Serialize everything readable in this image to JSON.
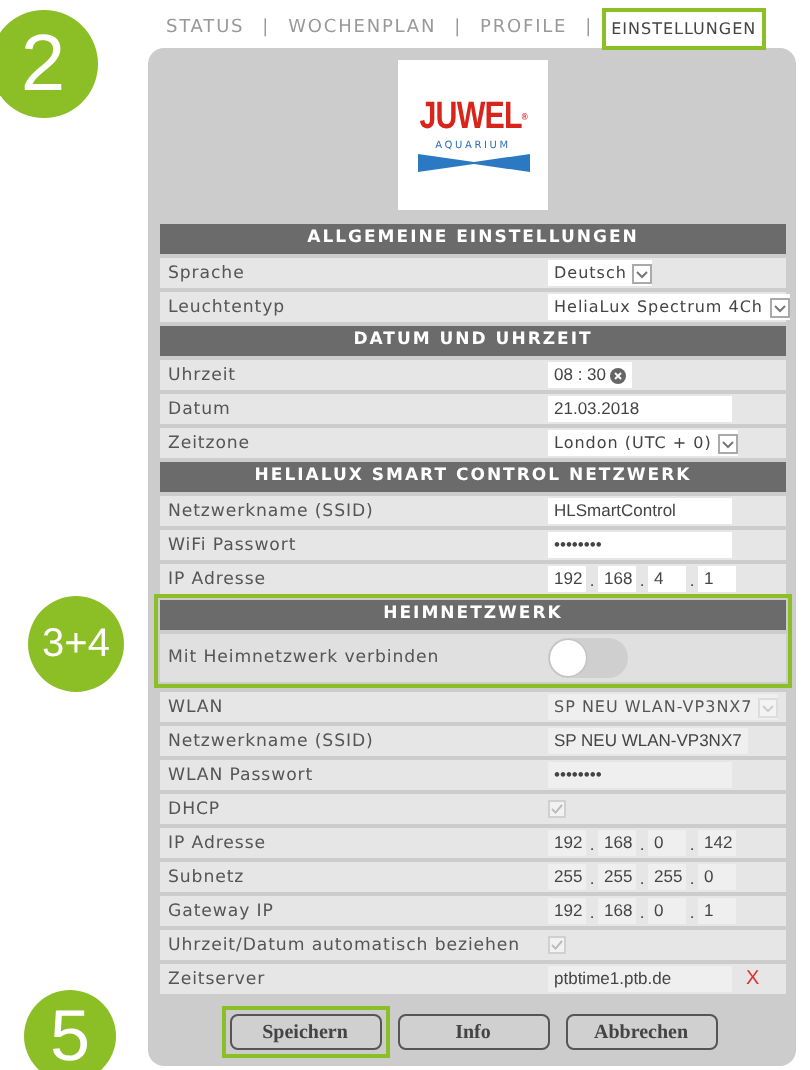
{
  "nav": {
    "callout": "2",
    "separator": "|",
    "items": [
      {
        "label": "STATUS",
        "selected": false,
        "highlighted": false
      },
      {
        "label": "WOCHENPLAN",
        "selected": false,
        "highlighted": false
      },
      {
        "label": "PROFILE",
        "selected": false,
        "highlighted": false
      },
      {
        "label": "EINSTELLUNGEN",
        "selected": true,
        "highlighted": true
      }
    ]
  },
  "logo": {
    "brand": "JUWEL",
    "mark": "®",
    "tagline": "AQUARIUM"
  },
  "ip_separator": ".",
  "sections": [
    {
      "title": "ALLGEMEINE EINSTELLUNGEN",
      "rows": [
        {
          "kind": "select",
          "label": "Sprache",
          "value": "Deutsch",
          "disabled": false
        },
        {
          "kind": "select",
          "label": "Leuchtentyp",
          "value": "HeliaLux Spectrum 4Ch",
          "disabled": false
        }
      ]
    },
    {
      "title": "DATUM UND UHRZEIT",
      "rows": [
        {
          "kind": "time",
          "label": "Uhrzeit",
          "value": "08 : 30"
        },
        {
          "kind": "text",
          "label": "Datum",
          "value": "21.03.2018",
          "disabled": false
        },
        {
          "kind": "select",
          "label": "Zeitzone",
          "value": "London (UTC + 0)",
          "disabled": false
        }
      ]
    },
    {
      "title": "HELIALUX SMART CONTROL NETZWERK",
      "rows": [
        {
          "kind": "text",
          "label": "Netzwerkname (SSID)",
          "value": "HLSmartControl",
          "disabled": false
        },
        {
          "kind": "password",
          "label": "WiFi Passwort",
          "value": "••••••••",
          "disabled": false
        },
        {
          "kind": "ip",
          "label": "IP Adresse",
          "value": [
            "192",
            "168",
            "4",
            "1"
          ],
          "disabled": false
        }
      ]
    },
    {
      "title": "HEIMNETZWERK",
      "highlighted": true,
      "callout": "3+4",
      "rows": [
        {
          "kind": "toggle",
          "label": "Mit Heimnetzwerk verbinden",
          "on": false
        }
      ]
    },
    {
      "rows": [
        {
          "kind": "select",
          "label": "WLAN",
          "value": "SP NEU WLAN-VP3NX7",
          "disabled": true
        },
        {
          "kind": "text",
          "label": "Netzwerkname (SSID)",
          "value": "SP NEU WLAN-VP3NX7",
          "disabled": true
        },
        {
          "kind": "password",
          "label": "WLAN Passwort",
          "value": "••••••••",
          "disabled": true
        },
        {
          "kind": "checkbox",
          "label": "DHCP",
          "checked": true,
          "disabled": true
        },
        {
          "kind": "ip",
          "label": "IP Adresse",
          "value": [
            "192",
            "168",
            "0",
            "142"
          ],
          "disabled": true
        },
        {
          "kind": "ip",
          "label": "Subnetz",
          "value": [
            "255",
            "255",
            "255",
            "0"
          ],
          "disabled": true
        },
        {
          "kind": "ip",
          "label": "Gateway IP",
          "value": [
            "192",
            "168",
            "0",
            "1"
          ],
          "disabled": true
        },
        {
          "kind": "checkbox",
          "label": "Uhrzeit/Datum automatisch beziehen",
          "checked": true,
          "disabled": true
        },
        {
          "kind": "text",
          "label": "Zeitserver",
          "value": "ptbtime1.ptb.de",
          "disabled": true,
          "clear": "X"
        }
      ]
    }
  ],
  "buttons": {
    "callout": "5",
    "items": [
      {
        "label": "Speichern",
        "highlighted": true
      },
      {
        "label": "Info"
      },
      {
        "label": "Abbrechen"
      }
    ]
  }
}
